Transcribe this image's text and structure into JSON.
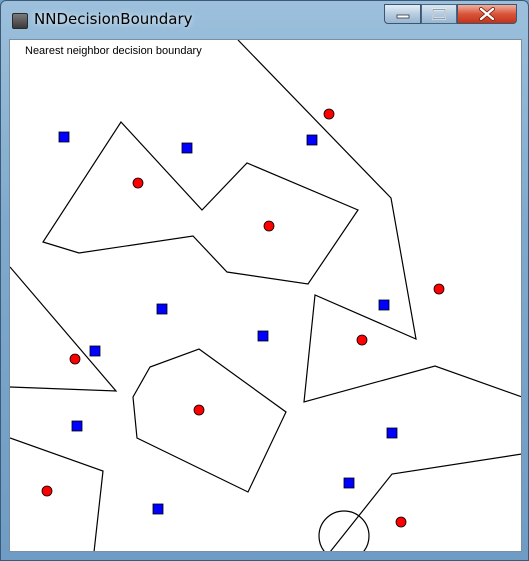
{
  "window": {
    "title": "NNDecisionBoundary",
    "icon": "app-icon",
    "controls": [
      "minimize-icon",
      "maximize-icon",
      "close-icon"
    ]
  },
  "caption": "Nearest neighbor decision boundary",
  "colors": {
    "class_a_fill": "#ff0000",
    "class_b_fill": "#0000ff",
    "boundary": "#000000",
    "background": "#ffffff"
  }
}
